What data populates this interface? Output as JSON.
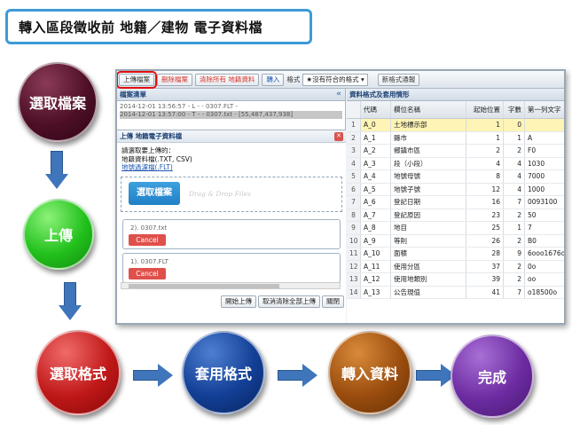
{
  "title": "轉入區段徵收前 地籍／建物 電子資料檔",
  "steps": {
    "select_file": "選取檔案",
    "upload": "上傳",
    "select_format": "選取格式",
    "apply_format": "套用格式",
    "import_data": "轉入資料",
    "done": "完成"
  },
  "colors": {
    "maroon": "#4e0f27",
    "green": "#22c11c",
    "red": "#c01818",
    "blue": "#123f95",
    "brown": "#9a4d0e",
    "purple": "#6c2ba1",
    "arrow": "#3f75bb",
    "title_border": "#3d9ad8"
  },
  "toolbar": {
    "upload_btn": "上傳檔案",
    "delete_btn": "刪除檔案",
    "clear_all_btn": "清除所有 地籍資料",
    "import_btn": "轉入",
    "format_label": "格式",
    "format_select": "★沒有符合的格式 ▾",
    "new_format_btn": "新格式通報"
  },
  "file_list": {
    "header": "檔案清單",
    "collapse_icon": "«",
    "entries": [
      "2014-12-01 13:56:57 - L - - 0307.FLT -",
      "2014-12-01 13:57:00 - T - - 0307.txt - [55,487,437,938]"
    ]
  },
  "upload_dialog": {
    "title": "上傳 地籍電子資料檔",
    "close_icon": "✕",
    "instructions": [
      "請選取要上傳的：",
      "地籍資料檔(.TXT, CSV)"
    ],
    "link": "地號過濾檔(.FLT)",
    "pick_button": "選取檔案",
    "drag_text": "Drag & Drop Files",
    "files": [
      {
        "name": "2). 0307.txt",
        "cancel": "Cancel"
      },
      {
        "name": "1). 0307.FLT",
        "cancel": "Cancel"
      }
    ],
    "footer": {
      "start_upload": "開始上傳",
      "cancel_clear": "取消清除全部上傳",
      "close": "關閉"
    }
  },
  "format_grid": {
    "header": "資料格式及套用情形",
    "columns": [
      "代碼",
      "欄位名稱",
      "起始位置",
      "字數",
      "第一列文字"
    ],
    "rows": [
      [
        "1",
        "A_0",
        "土地標示部",
        "1",
        "0",
        ""
      ],
      [
        "2",
        "A_1",
        "縣市",
        "1",
        "1",
        "A"
      ],
      [
        "3",
        "A_2",
        "鄉鎮市區",
        "2",
        "2",
        "F0"
      ],
      [
        "4",
        "A_3",
        "段（小段）",
        "4",
        "4",
        "1030"
      ],
      [
        "5",
        "A_4",
        "地號母號",
        "8",
        "4",
        "7000"
      ],
      [
        "6",
        "A_5",
        "地號子號",
        "12",
        "4",
        "1000"
      ],
      [
        "7",
        "A_6",
        "登記日期",
        "16",
        "7",
        "0093100"
      ],
      [
        "8",
        "A_7",
        "登記原因",
        "23",
        "2",
        "50"
      ],
      [
        "9",
        "A_8",
        "地目",
        "25",
        "1",
        "7"
      ],
      [
        "10",
        "A_9",
        "等則",
        "26",
        "2",
        "B0"
      ],
      [
        "11",
        "A_10",
        "面積",
        "28",
        "9",
        "6ooo1676o"
      ],
      [
        "12",
        "A_11",
        "使用分區",
        "37",
        "2",
        "0o"
      ],
      [
        "13",
        "A_12",
        "使用地類別",
        "39",
        "2",
        "oo"
      ],
      [
        "14",
        "A_13",
        "公告現值",
        "41",
        "7",
        "o18500o"
      ]
    ]
  }
}
